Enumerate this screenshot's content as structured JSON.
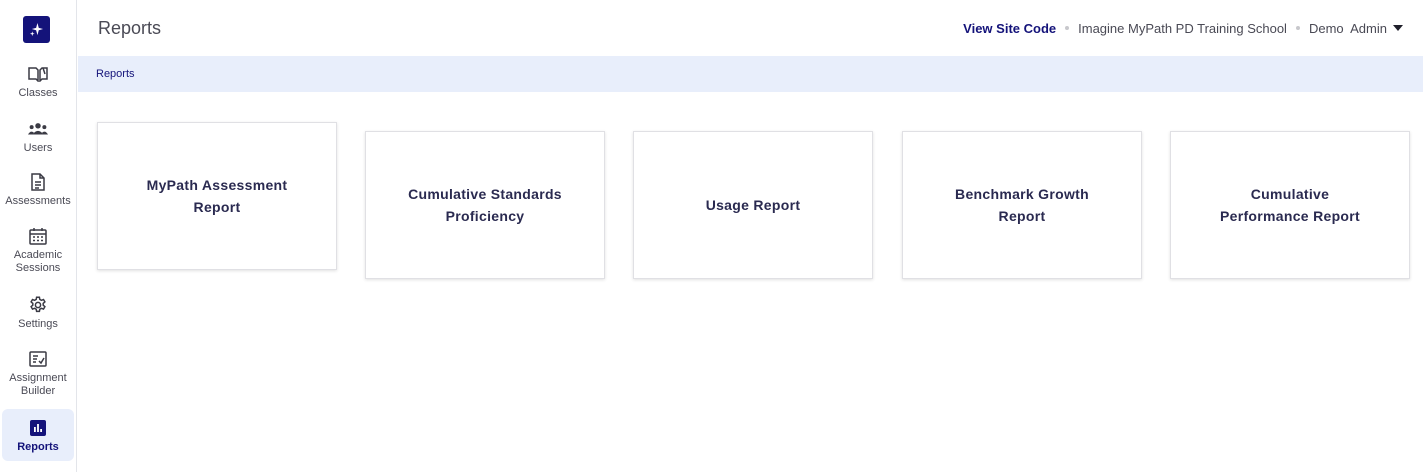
{
  "sidebar": {
    "items": [
      {
        "label": "Classes",
        "icon": "book-icon"
      },
      {
        "label": "Users",
        "icon": "users-icon"
      },
      {
        "label": "Assessments",
        "icon": "document-icon"
      },
      {
        "label": "Academic Sessions",
        "icon": "calendar-icon"
      },
      {
        "label": "Settings",
        "icon": "gear-icon"
      },
      {
        "label": "Assignment Builder",
        "icon": "checklist-icon"
      },
      {
        "label": "Reports",
        "icon": "bar-chart-icon"
      }
    ]
  },
  "header": {
    "title": "Reports",
    "site_code_label": "View Site Code",
    "school_name": "Imagine MyPath PD Training School",
    "user_name": "Demo  Admin"
  },
  "breadcrumb": {
    "current": "Reports"
  },
  "cards": [
    {
      "label": "MyPath Assessment Report"
    },
    {
      "label": "Cumulative Standards Proficiency"
    },
    {
      "label": "Usage Report"
    },
    {
      "label": "Benchmark Growth Report"
    },
    {
      "label": "Cumulative Performance Report"
    }
  ],
  "colors": {
    "brand": "#14137a",
    "highlight": "#e8eefb"
  }
}
